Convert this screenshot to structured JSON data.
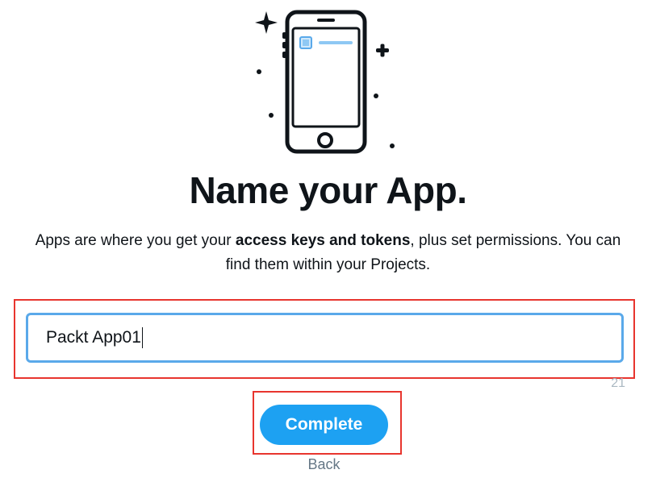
{
  "header": {
    "title": "Name your App."
  },
  "description": {
    "part1": "Apps are where you get your ",
    "bold": "access keys and tokens",
    "part2": ", plus set permissions. You can find them within your Projects."
  },
  "form": {
    "app_name_value": "Packt App01",
    "char_count": "21"
  },
  "actions": {
    "complete_label": "Complete",
    "back_label": "Back"
  },
  "colors": {
    "accent": "#1da1f2",
    "input_border": "#5aa9ea",
    "highlight": "#e8352e",
    "muted": "#657786"
  },
  "icons": {
    "illustration": "phone-illustration-icon"
  }
}
